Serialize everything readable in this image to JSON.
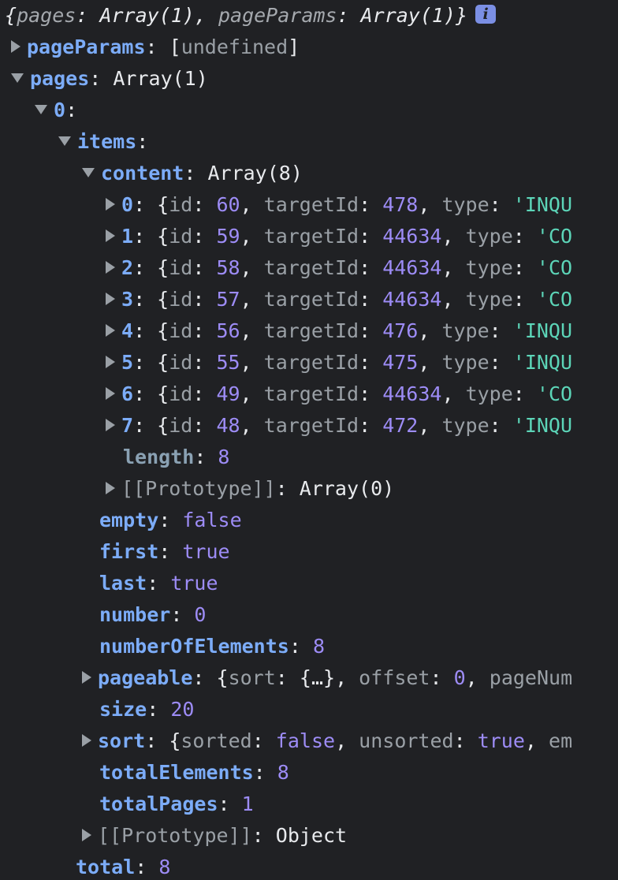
{
  "header": {
    "summary_open": "{",
    "summary_key1": "pages",
    "summary_val1": "Array(1)",
    "summary_key2": "pageParams",
    "summary_val2": "Array(1)",
    "summary_close": "}",
    "info_icon_text": "i"
  },
  "pageParams": {
    "key": "pageParams",
    "open": "[",
    "value": "undefined",
    "close": "]"
  },
  "pages": {
    "key": "pages",
    "value": "Array(1)"
  },
  "page0": {
    "key": "0"
  },
  "items": {
    "key": "items"
  },
  "content": {
    "key": "content",
    "value": "Array(8)",
    "rows": [
      {
        "index": "0",
        "id": "60",
        "targetId": "478",
        "type": "'INQU"
      },
      {
        "index": "1",
        "id": "59",
        "targetId": "44634",
        "type": "'CO"
      },
      {
        "index": "2",
        "id": "58",
        "targetId": "44634",
        "type": "'CO"
      },
      {
        "index": "3",
        "id": "57",
        "targetId": "44634",
        "type": "'CO"
      },
      {
        "index": "4",
        "id": "56",
        "targetId": "476",
        "type": "'INQU"
      },
      {
        "index": "5",
        "id": "55",
        "targetId": "475",
        "type": "'INQU"
      },
      {
        "index": "6",
        "id": "49",
        "targetId": "44634",
        "type": "'CO"
      },
      {
        "index": "7",
        "id": "48",
        "targetId": "472",
        "type": "'INQU"
      }
    ],
    "length_key": "length",
    "length_value": "8",
    "proto_key": "[[Prototype]]",
    "proto_value": "Array(0)"
  },
  "labels": {
    "id": "id",
    "targetId": "targetId",
    "type": "type"
  },
  "props": {
    "empty": {
      "key": "empty",
      "value": "false"
    },
    "first": {
      "key": "first",
      "value": "true"
    },
    "last": {
      "key": "last",
      "value": "true"
    },
    "number": {
      "key": "number",
      "value": "0"
    },
    "numberOfElements": {
      "key": "numberOfElements",
      "value": "8"
    },
    "pageable": {
      "key": "pageable",
      "sort_key": "sort",
      "sort_value": "{…}",
      "offset_key": "offset",
      "offset_value": "0",
      "pagenum_key": "pageNum"
    },
    "size": {
      "key": "size",
      "value": "20"
    },
    "sort": {
      "key": "sort",
      "sorted_key": "sorted",
      "sorted_value": "false",
      "unsorted_key": "unsorted",
      "unsorted_value": "true",
      "em_key": "em"
    },
    "totalElements": {
      "key": "totalElements",
      "value": "8"
    },
    "totalPages": {
      "key": "totalPages",
      "value": "1"
    },
    "proto": {
      "key": "[[Prototype]]",
      "value": "Object"
    }
  },
  "total": {
    "key": "total",
    "value": "8"
  },
  "colors": {
    "background": "#202124",
    "key": "#7cacf8",
    "string": "#5cd5b8",
    "number": "#9d8cf6",
    "punctuation": "#e8eaed",
    "muted": "#9aa0a6"
  },
  "icons": {
    "expand": "triangle-right",
    "collapse": "triangle-down",
    "info": "info-badge"
  }
}
